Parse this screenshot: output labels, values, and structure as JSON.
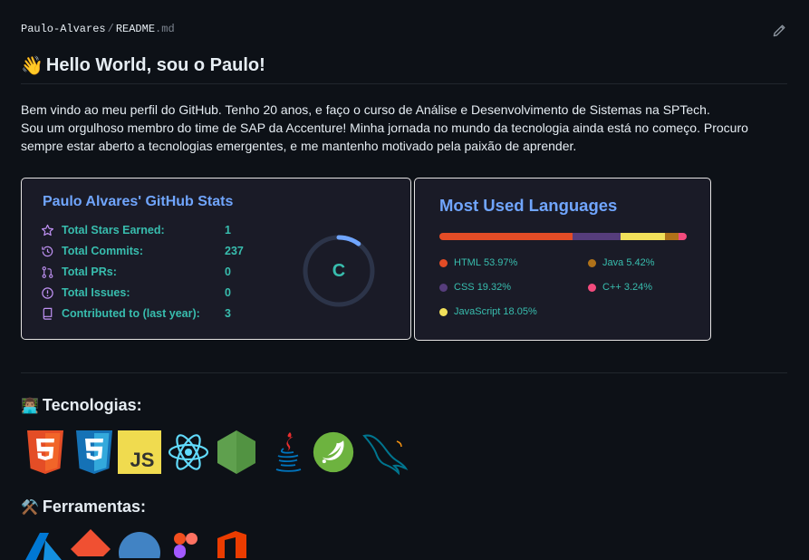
{
  "breadcrumb": {
    "owner": "Paulo-Alvares",
    "separator": "/",
    "file_name": "README",
    "file_ext": ".md"
  },
  "header": {
    "title": "Hello World, sou o Paulo!",
    "emoji": "👋"
  },
  "intro": {
    "line1": "Bem vindo ao meu perfil do GitHub. Tenho 20 anos, e faço o curso de Análise e Desenvolvimento de Sistemas na SPTech.",
    "line2": "Sou um orgulhoso membro do time de SAP da Accenture! Minha jornada no mundo da tecnologia ainda está no começo. Procuro sempre estar aberto a tecnologias emergentes, e me mantenho motivado pela paixão de aprender."
  },
  "stats_card": {
    "title": "Paulo Alvares' GitHub Stats",
    "rows": [
      {
        "label": "Total Stars Earned:",
        "value": "1",
        "icon": "star-icon"
      },
      {
        "label": "Total Commits:",
        "value": "237",
        "icon": "history-icon"
      },
      {
        "label": "Total PRs:",
        "value": "0",
        "icon": "pull-request-icon"
      },
      {
        "label": "Total Issues:",
        "value": "0",
        "icon": "issue-icon"
      },
      {
        "label": "Contributed to (last year):",
        "value": "3",
        "icon": "repo-icon"
      }
    ],
    "rank": "C",
    "rank_progress": 0.1,
    "colors": {
      "title": "#70a5fd",
      "text": "#38bdae",
      "icon": "#bf91f3",
      "bg": "#1a1b27"
    }
  },
  "languages_card": {
    "title": "Most Used Languages",
    "languages": [
      {
        "name": "HTML",
        "percent": "53.97%",
        "value": 53.97,
        "color": "#e34c26"
      },
      {
        "name": "CSS",
        "percent": "19.32%",
        "value": 19.32,
        "color": "#563d7c"
      },
      {
        "name": "JavaScript",
        "percent": "18.05%",
        "value": 18.05,
        "color": "#f1e05a"
      },
      {
        "name": "Java",
        "percent": "5.42%",
        "value": 5.42,
        "color": "#b07219"
      },
      {
        "name": "C++",
        "percent": "3.24%",
        "value": 3.24,
        "color": "#f34b7d"
      }
    ]
  },
  "tecnologias": {
    "heading": "Tecnologias:",
    "emoji": "👨🏽‍💻",
    "icons": [
      "html5-icon",
      "css3-icon",
      "javascript-icon",
      "react-icon",
      "nodejs-icon",
      "java-icon",
      "spring-icon",
      "mysql-icon"
    ]
  },
  "ferramentas": {
    "heading": "Ferramentas:",
    "emoji": "⚒️",
    "icons": [
      "azure-icon",
      "git-icon",
      "github-icon",
      "figma-icon",
      "office-icon"
    ]
  }
}
